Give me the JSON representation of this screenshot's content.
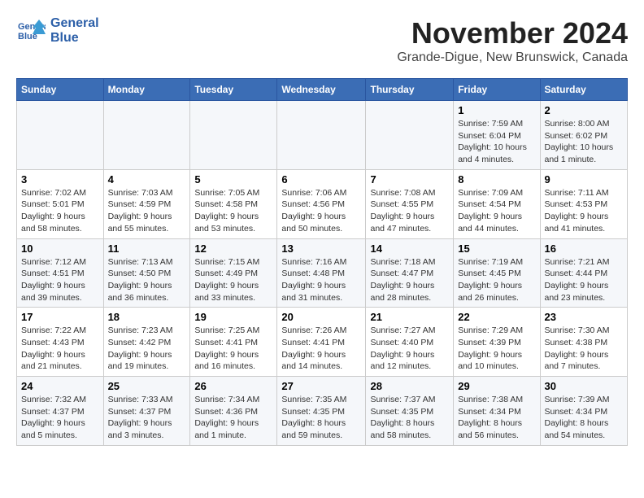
{
  "header": {
    "logo_line1": "General",
    "logo_line2": "Blue",
    "title": "November 2024",
    "subtitle": "Grande-Digue, New Brunswick, Canada"
  },
  "calendar": {
    "weekdays": [
      "Sunday",
      "Monday",
      "Tuesday",
      "Wednesday",
      "Thursday",
      "Friday",
      "Saturday"
    ],
    "weeks": [
      [
        {
          "day": "",
          "info": ""
        },
        {
          "day": "",
          "info": ""
        },
        {
          "day": "",
          "info": ""
        },
        {
          "day": "",
          "info": ""
        },
        {
          "day": "",
          "info": ""
        },
        {
          "day": "1",
          "info": "Sunrise: 7:59 AM\nSunset: 6:04 PM\nDaylight: 10 hours and 4 minutes."
        },
        {
          "day": "2",
          "info": "Sunrise: 8:00 AM\nSunset: 6:02 PM\nDaylight: 10 hours and 1 minute."
        }
      ],
      [
        {
          "day": "3",
          "info": "Sunrise: 7:02 AM\nSunset: 5:01 PM\nDaylight: 9 hours and 58 minutes."
        },
        {
          "day": "4",
          "info": "Sunrise: 7:03 AM\nSunset: 4:59 PM\nDaylight: 9 hours and 55 minutes."
        },
        {
          "day": "5",
          "info": "Sunrise: 7:05 AM\nSunset: 4:58 PM\nDaylight: 9 hours and 53 minutes."
        },
        {
          "day": "6",
          "info": "Sunrise: 7:06 AM\nSunset: 4:56 PM\nDaylight: 9 hours and 50 minutes."
        },
        {
          "day": "7",
          "info": "Sunrise: 7:08 AM\nSunset: 4:55 PM\nDaylight: 9 hours and 47 minutes."
        },
        {
          "day": "8",
          "info": "Sunrise: 7:09 AM\nSunset: 4:54 PM\nDaylight: 9 hours and 44 minutes."
        },
        {
          "day": "9",
          "info": "Sunrise: 7:11 AM\nSunset: 4:53 PM\nDaylight: 9 hours and 41 minutes."
        }
      ],
      [
        {
          "day": "10",
          "info": "Sunrise: 7:12 AM\nSunset: 4:51 PM\nDaylight: 9 hours and 39 minutes."
        },
        {
          "day": "11",
          "info": "Sunrise: 7:13 AM\nSunset: 4:50 PM\nDaylight: 9 hours and 36 minutes."
        },
        {
          "day": "12",
          "info": "Sunrise: 7:15 AM\nSunset: 4:49 PM\nDaylight: 9 hours and 33 minutes."
        },
        {
          "day": "13",
          "info": "Sunrise: 7:16 AM\nSunset: 4:48 PM\nDaylight: 9 hours and 31 minutes."
        },
        {
          "day": "14",
          "info": "Sunrise: 7:18 AM\nSunset: 4:47 PM\nDaylight: 9 hours and 28 minutes."
        },
        {
          "day": "15",
          "info": "Sunrise: 7:19 AM\nSunset: 4:45 PM\nDaylight: 9 hours and 26 minutes."
        },
        {
          "day": "16",
          "info": "Sunrise: 7:21 AM\nSunset: 4:44 PM\nDaylight: 9 hours and 23 minutes."
        }
      ],
      [
        {
          "day": "17",
          "info": "Sunrise: 7:22 AM\nSunset: 4:43 PM\nDaylight: 9 hours and 21 minutes."
        },
        {
          "day": "18",
          "info": "Sunrise: 7:23 AM\nSunset: 4:42 PM\nDaylight: 9 hours and 19 minutes."
        },
        {
          "day": "19",
          "info": "Sunrise: 7:25 AM\nSunset: 4:41 PM\nDaylight: 9 hours and 16 minutes."
        },
        {
          "day": "20",
          "info": "Sunrise: 7:26 AM\nSunset: 4:41 PM\nDaylight: 9 hours and 14 minutes."
        },
        {
          "day": "21",
          "info": "Sunrise: 7:27 AM\nSunset: 4:40 PM\nDaylight: 9 hours and 12 minutes."
        },
        {
          "day": "22",
          "info": "Sunrise: 7:29 AM\nSunset: 4:39 PM\nDaylight: 9 hours and 10 minutes."
        },
        {
          "day": "23",
          "info": "Sunrise: 7:30 AM\nSunset: 4:38 PM\nDaylight: 9 hours and 7 minutes."
        }
      ],
      [
        {
          "day": "24",
          "info": "Sunrise: 7:32 AM\nSunset: 4:37 PM\nDaylight: 9 hours and 5 minutes."
        },
        {
          "day": "25",
          "info": "Sunrise: 7:33 AM\nSunset: 4:37 PM\nDaylight: 9 hours and 3 minutes."
        },
        {
          "day": "26",
          "info": "Sunrise: 7:34 AM\nSunset: 4:36 PM\nDaylight: 9 hours and 1 minute."
        },
        {
          "day": "27",
          "info": "Sunrise: 7:35 AM\nSunset: 4:35 PM\nDaylight: 8 hours and 59 minutes."
        },
        {
          "day": "28",
          "info": "Sunrise: 7:37 AM\nSunset: 4:35 PM\nDaylight: 8 hours and 58 minutes."
        },
        {
          "day": "29",
          "info": "Sunrise: 7:38 AM\nSunset: 4:34 PM\nDaylight: 8 hours and 56 minutes."
        },
        {
          "day": "30",
          "info": "Sunrise: 7:39 AM\nSunset: 4:34 PM\nDaylight: 8 hours and 54 minutes."
        }
      ]
    ]
  }
}
